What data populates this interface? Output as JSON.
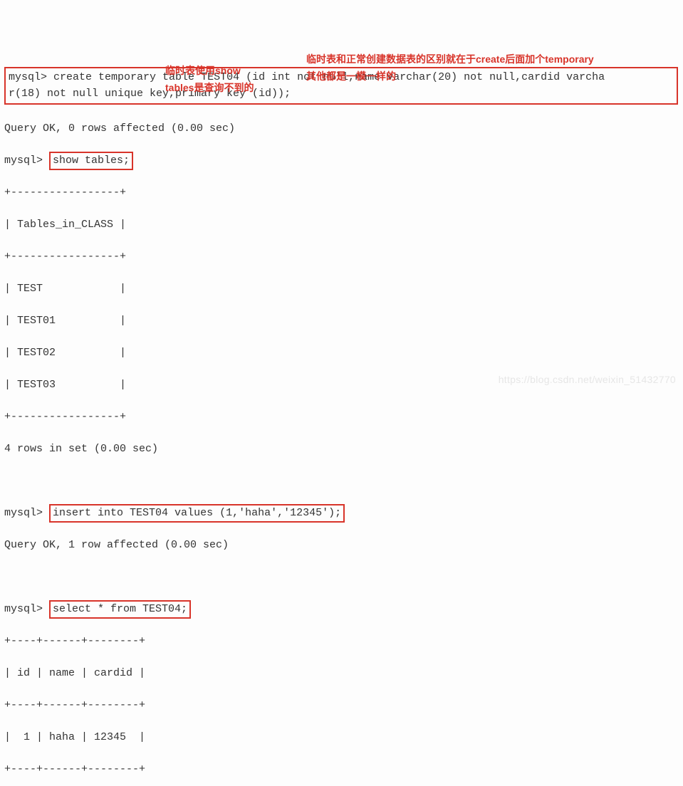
{
  "prompt": "mysql>",
  "create_stmt_l1": "create temporary table TEST04 (id int not null,name varchar(20) not null,cardid varcha",
  "create_stmt_l2": "r(18) not null unique key,primary key (id));",
  "query_ok_0": "Query OK, 0 rows affected (0.00 sec)",
  "show_tables": "show tables;",
  "annot_show_l1": "临时表使用show",
  "annot_show_l2": "tables是查询不到的",
  "annot_temp_l1": "临时表和正常创建数据表的区别就在于create后面加个temporary",
  "annot_temp_l2": "其他都是一模一样的",
  "tbl_border_top": "+-----------------+",
  "tbl_header": "| Tables_in_CLASS |",
  "tbl_rows": [
    "| TEST            |",
    "| TEST01          |",
    "| TEST02          |",
    "| TEST03          |"
  ],
  "rows_in_set_4": "4 rows in set (0.00 sec)",
  "insert_stmt": "insert into TEST04 values (1,'haha','12345');",
  "query_ok_1": "Query OK, 1 row affected (0.00 sec)",
  "select_stmt": "select * from TEST04;",
  "res_border": "+----+------+--------+",
  "res_header": "| id | name | cardid |",
  "res_row": "|  1 | haha | 12345  |",
  "watermark": "https://blog.csdn.net/weixin_51432770"
}
